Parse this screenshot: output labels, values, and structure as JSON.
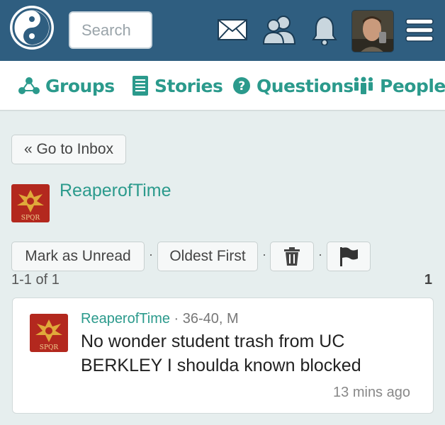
{
  "header": {
    "search_placeholder": "Search",
    "icons": [
      "yin-yang-logo-icon",
      "mail-icon",
      "friends-icon",
      "bell-icon",
      "avatar",
      "menu-icon"
    ]
  },
  "nav": {
    "items": [
      {
        "label": "Groups",
        "icon": "groups-icon"
      },
      {
        "label": "Stories",
        "icon": "stories-icon"
      },
      {
        "label": "Questions",
        "icon": "question-icon"
      },
      {
        "label": "People",
        "icon": "people-icon"
      }
    ]
  },
  "inbox": {
    "back_label": "« Go to Inbox",
    "sender": "ReaperofTime",
    "mark_unread_label": "Mark as Unread",
    "sort_label": "Oldest First",
    "separator": "·",
    "range_label": "1-1 of 1",
    "page_number": "1"
  },
  "message": {
    "sender": "ReaperofTime",
    "demographics": " · 36-40, M",
    "text": "No wonder student trash from UC BERKLEY I shoulda known blocked",
    "time": "13 mins ago"
  },
  "colors": {
    "header_bg": "#2f5e80",
    "accent": "#2b9a8c",
    "page_bg": "#e6eeee"
  }
}
